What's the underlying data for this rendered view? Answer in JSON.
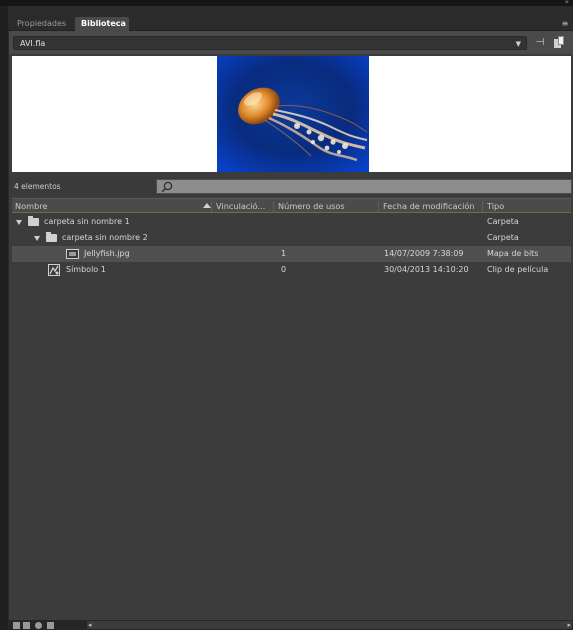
{
  "topbar": {
    "collapse_icon": "double-chevron-right-icon",
    "collapse_glyph": "»"
  },
  "tabs": [
    {
      "label": "Propiedades",
      "active": false
    },
    {
      "label": "Biblioteca",
      "active": true
    }
  ],
  "panel_menu_glyph": "≡",
  "document": {
    "filename": "AVI.fla",
    "dropdown_glyph": "▼",
    "pin_glyph": "⊣"
  },
  "preview": {
    "image": "jellyfish-photo"
  },
  "search": {
    "item_count": "4 elementos",
    "value": ""
  },
  "columns": {
    "name": "Nombre",
    "linkage": "Vinculació...",
    "uses": "Número de usos",
    "modified": "Fecha de modificación",
    "type": "Tipo"
  },
  "items": [
    {
      "name": "carpeta sin nombre 1",
      "uses": "",
      "modified": "",
      "type": "Carpeta"
    },
    {
      "name": "carpeta sin nombre 2",
      "uses": "",
      "modified": "",
      "type": "Carpeta"
    },
    {
      "name": "Jellyfish.jpg",
      "uses": "1",
      "modified": "14/07/2009 7:38:09",
      "type": "Mapa de bits"
    },
    {
      "name": "Símbolo 1",
      "uses": "0",
      "modified": "30/04/2013 14:10:20",
      "type": "Clip de película"
    }
  ],
  "scroll": {
    "left_glyph": "◂",
    "right_glyph": "▸"
  },
  "colors": {
    "panel_bg": "#3c3c3c",
    "header_accent": "#7a6a38",
    "preview_bg": "#ffffff"
  }
}
